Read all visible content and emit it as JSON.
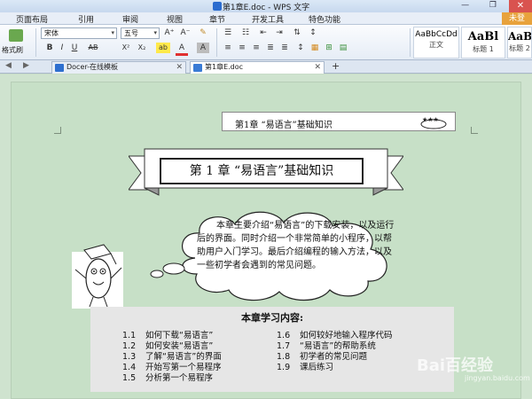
{
  "window": {
    "title": "第1章E.doc - WPS 文字",
    "minmax": "— ❐",
    "close_glyph": "✕"
  },
  "menu": {
    "items": [
      "页面布局",
      "引用",
      "审阅",
      "视图",
      "章节",
      "开发工具",
      "特色功能"
    ],
    "unregistered": "未登"
  },
  "toolbar": {
    "format_painter": "格式刷",
    "font_name": "宋体",
    "font_size": "五号",
    "grow_font": "A⁺",
    "shrink_font": "A⁻",
    "clear_format": "✎",
    "bold": "B",
    "italic": "I",
    "underline": "U",
    "strikethrough": "AB",
    "superscript": "X²",
    "subscript": "X₂",
    "highlight": "ab",
    "font_color": "A",
    "char_shading": "A"
  },
  "styles": [
    {
      "sample": "AaBbCcDd",
      "name": "正文"
    },
    {
      "sample": "AaBl",
      "name": "标题 1"
    },
    {
      "sample": "AaB",
      "name": "标题 2"
    }
  ],
  "tabs": [
    {
      "label": "Docer-在线模板",
      "active": false
    },
    {
      "label": "第1章E.doc",
      "active": true
    }
  ],
  "tab_close": "✕",
  "new_tab": "+",
  "nav": {
    "back": "◀",
    "forward": "▶"
  },
  "document": {
    "header_banner": "第1章 “易语言”基础知识",
    "chapter_title": "第 1 章 “易语言”基础知识",
    "intro": "本章主要介绍“易语言”的下载安装，以及运行后的界面。同时介绍一个非常简单的小程序，以帮助用户入门学习。最后介绍编程的输入方法，以及一些初学者会遇到的常见问题。",
    "study_heading": "本章学习内容:",
    "study_left": [
      {
        "num": "1.1",
        "text": "如何下载“易语言”"
      },
      {
        "num": "1.2",
        "text": "如何安装“易语言”"
      },
      {
        "num": "1.3",
        "text": "了解“易语言”的界面"
      },
      {
        "num": "1.4",
        "text": "开始写第一个易程序"
      },
      {
        "num": "1.5",
        "text": "分析第一个易程序"
      }
    ],
    "study_right": [
      {
        "num": "1.6",
        "text": "如何较好地输入程序代码"
      },
      {
        "num": "1.7",
        "text": "“易语言”的帮助系统"
      },
      {
        "num": "1.8",
        "text": "初学者的常见问题"
      },
      {
        "num": "1.9",
        "text": "课后练习"
      }
    ]
  },
  "watermark": {
    "brand": "Bai百经验",
    "sub": "jingyan.baidu.com"
  }
}
